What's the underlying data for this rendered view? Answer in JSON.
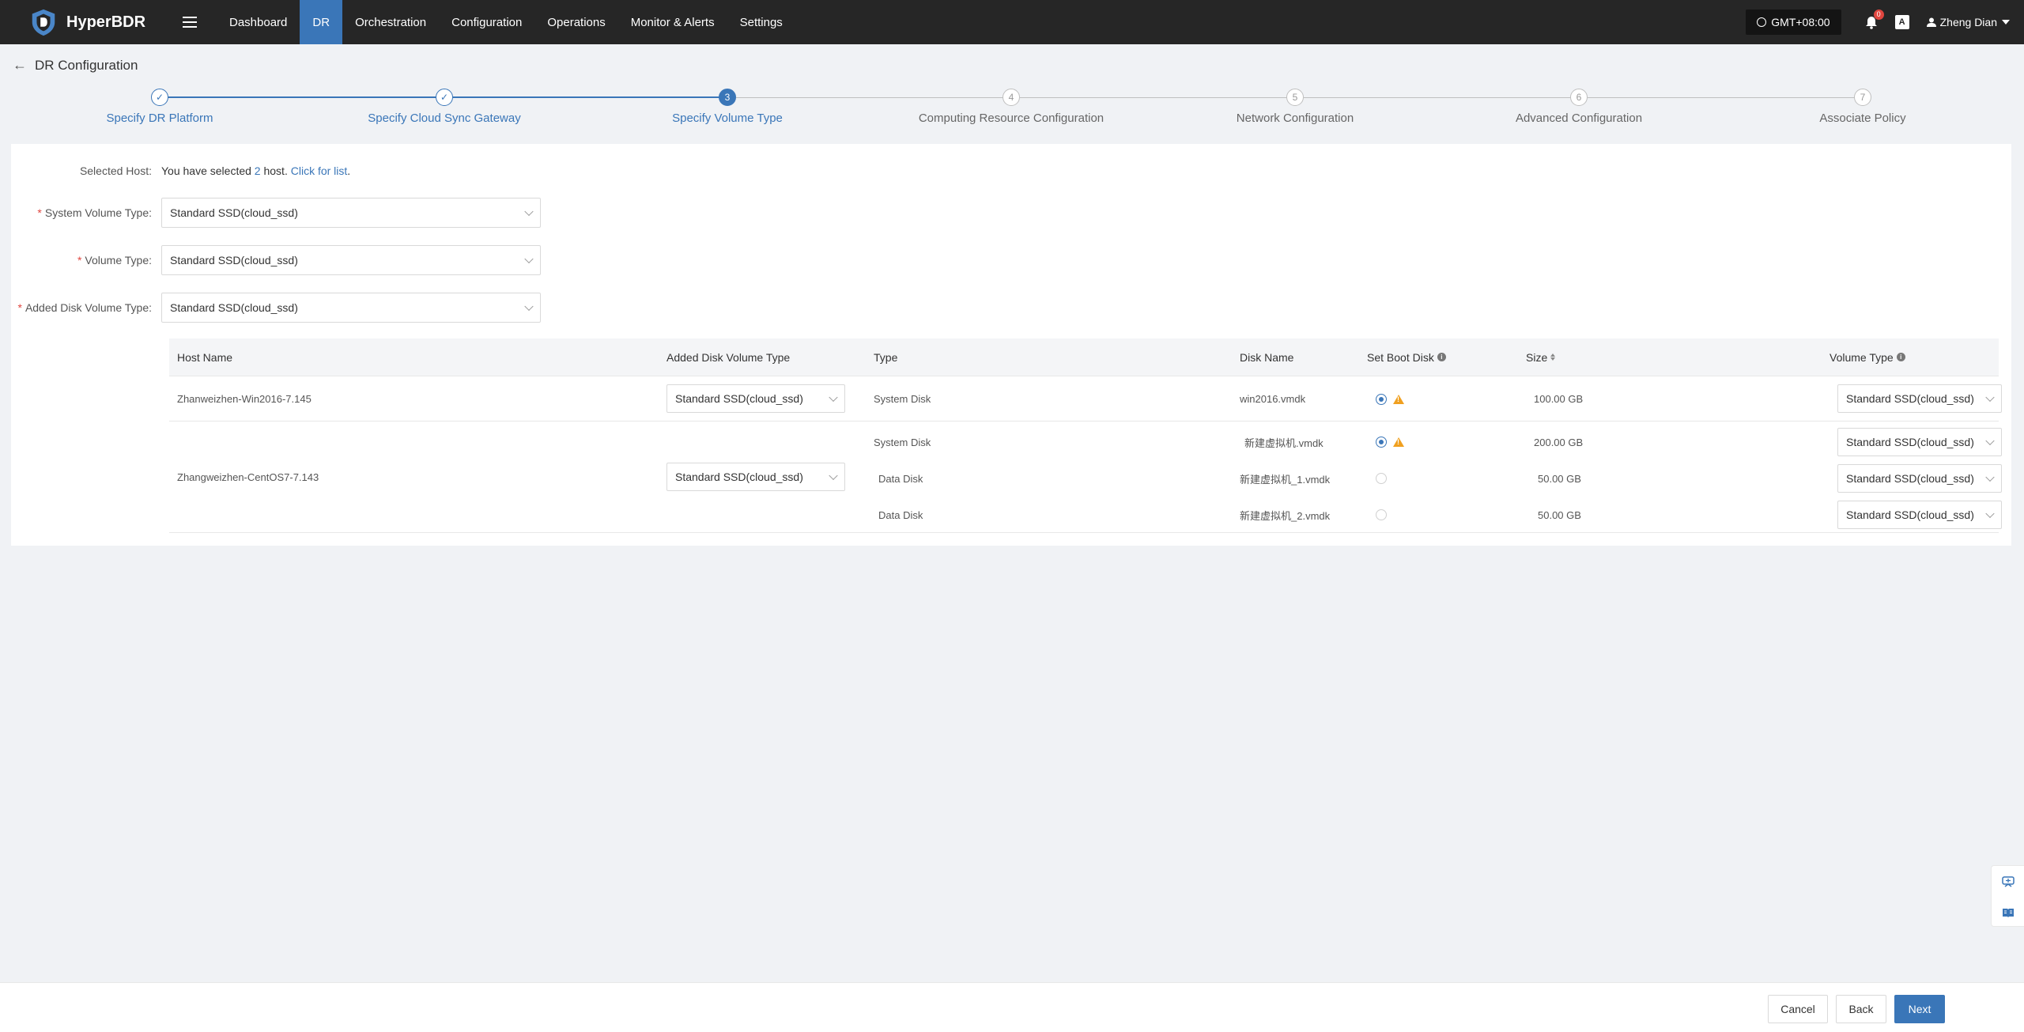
{
  "app": {
    "name": "HyperBDR"
  },
  "nav": {
    "items": [
      {
        "label": "Dashboard",
        "active": false
      },
      {
        "label": "DR",
        "active": true
      },
      {
        "label": "Orchestration",
        "active": false
      },
      {
        "label": "Configuration",
        "active": false
      },
      {
        "label": "Operations",
        "active": false
      },
      {
        "label": "Monitor & Alerts",
        "active": false
      },
      {
        "label": "Settings",
        "active": false
      }
    ],
    "timezone": "GMT+08:00",
    "notification_count": "0",
    "lang_glyph": "A",
    "user": "Zheng Dian"
  },
  "page": {
    "title": "DR Configuration"
  },
  "steps": [
    {
      "num": "1",
      "label": "Specify DR Platform",
      "status": "done"
    },
    {
      "num": "2",
      "label": "Specify Cloud Sync Gateway",
      "status": "done"
    },
    {
      "num": "3",
      "label": "Specify Volume Type",
      "status": "current"
    },
    {
      "num": "4",
      "label": "Computing Resource Configuration",
      "status": "pending"
    },
    {
      "num": "5",
      "label": "Network Configuration",
      "status": "pending"
    },
    {
      "num": "6",
      "label": "Advanced Configuration",
      "status": "pending"
    },
    {
      "num": "7",
      "label": "Associate Policy",
      "status": "pending"
    }
  ],
  "form": {
    "selected_host_label": "Selected Host:",
    "selected_text_pre": "You have selected ",
    "selected_count": "2",
    "selected_text_post": " host. ",
    "click_for_list": "Click for list",
    "period": ".",
    "system_volume_label": "System Volume Type:",
    "system_volume_value": "Standard SSD(cloud_ssd)",
    "volume_label": "Volume Type:",
    "volume_value": "Standard SSD(cloud_ssd)",
    "added_disk_label": "Added Disk Volume Type:",
    "added_disk_value": "Standard SSD(cloud_ssd)"
  },
  "table": {
    "headers": {
      "host_name": "Host Name",
      "added_disk_volume_type": "Added Disk Volume Type",
      "type": "Type",
      "disk_name": "Disk Name",
      "set_boot_disk": "Set Boot Disk",
      "size": "Size",
      "volume_type": "Volume Type"
    },
    "hosts": [
      {
        "name": "Zhanweizhen-Win2016-7.145",
        "added_disk_volume_type": "Standard SSD(cloud_ssd)",
        "disks": [
          {
            "type": "System Disk",
            "name": "win2016.vmdk",
            "boot": true,
            "warn": true,
            "size": "100.00 GB",
            "volume_type": "Standard SSD(cloud_ssd)"
          }
        ]
      },
      {
        "name": "Zhangweizhen-CentOS7-7.143",
        "added_disk_volume_type": "Standard SSD(cloud_ssd)",
        "disks": [
          {
            "type": "System Disk",
            "name": "新建虚拟机.vmdk",
            "boot": true,
            "warn": true,
            "size": "200.00 GB",
            "volume_type": "Standard SSD(cloud_ssd)"
          },
          {
            "type": "Data Disk",
            "name": "新建虚拟机_1.vmdk",
            "boot": false,
            "warn": false,
            "size": "50.00 GB",
            "volume_type": "Standard SSD(cloud_ssd)"
          },
          {
            "type": "Data Disk",
            "name": "新建虚拟机_2.vmdk",
            "boot": false,
            "warn": false,
            "size": "50.00 GB",
            "volume_type": "Standard SSD(cloud_ssd)"
          }
        ]
      }
    ]
  },
  "footer": {
    "cancel": "Cancel",
    "back": "Back",
    "next": "Next"
  },
  "colors": {
    "accent": "#3a76b8",
    "topbar": "#262626",
    "warning": "#f0a020",
    "required": "#e0463f"
  },
  "icons": [
    "shield-logo-icon",
    "menu-icon",
    "clock-icon",
    "bell-icon",
    "language-icon",
    "user-icon",
    "back-arrow-icon",
    "check-icon",
    "chevron-down-icon",
    "info-icon",
    "sort-icon",
    "warning-icon",
    "translate-icon",
    "book-icon"
  ]
}
